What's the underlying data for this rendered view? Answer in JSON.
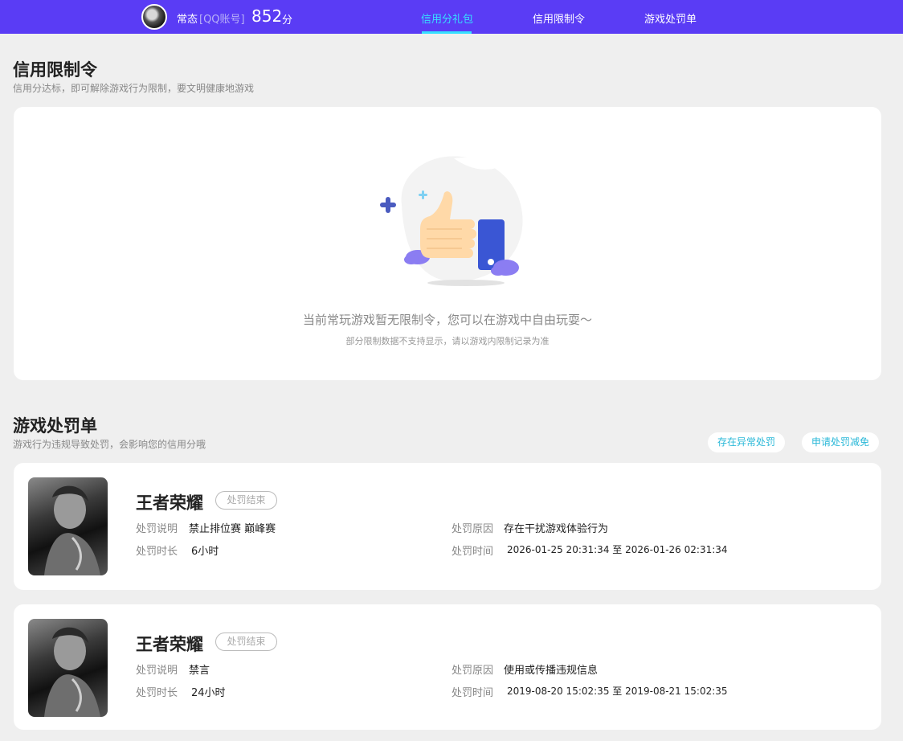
{
  "header": {
    "nickname": "常态",
    "account_type": "[QQ账号]",
    "score": "852",
    "score_unit": "分",
    "nav": [
      "信用分礼包",
      "信用限制令",
      "游戏处罚单"
    ],
    "active_nav": "信用分礼包",
    "accent": "#5a3cf5"
  },
  "restriction": {
    "title": "信用限制令",
    "subtitle": "信用分达标，即可解除游戏行为限制，要文明健康地游戏",
    "empty_message": "当前常玩游戏暂无限制令，您可以在游戏中自由玩耍～",
    "empty_note": "部分限制数据不支持显示，请以游戏内限制记录为准"
  },
  "penalties": {
    "title": "游戏处罚单",
    "subtitle": "游戏行为违规导致处罚，会影响您的信用分哦",
    "btn_abnormal": "存在异常处罚",
    "btn_appeal": "申请处罚减免",
    "labels": {
      "desc": "处罚说明",
      "duration": "处罚时长",
      "reason": "处罚原因",
      "time": "处罚时间"
    },
    "items": [
      {
        "game": "王者荣耀",
        "status": "处罚结束",
        "desc": "禁止排位赛 巅峰赛",
        "duration": "6小时",
        "reason": "存在干扰游戏体验行为",
        "time": "2026-01-25 20:31:34 至 2026-01-26 02:31:34"
      },
      {
        "game": "王者荣耀",
        "status": "处罚结束",
        "desc": "禁言",
        "duration": "24小时",
        "reason": "使用或传播违规信息",
        "time": "2019-08-20 15:02:35 至 2019-08-21 15:02:35"
      }
    ]
  }
}
